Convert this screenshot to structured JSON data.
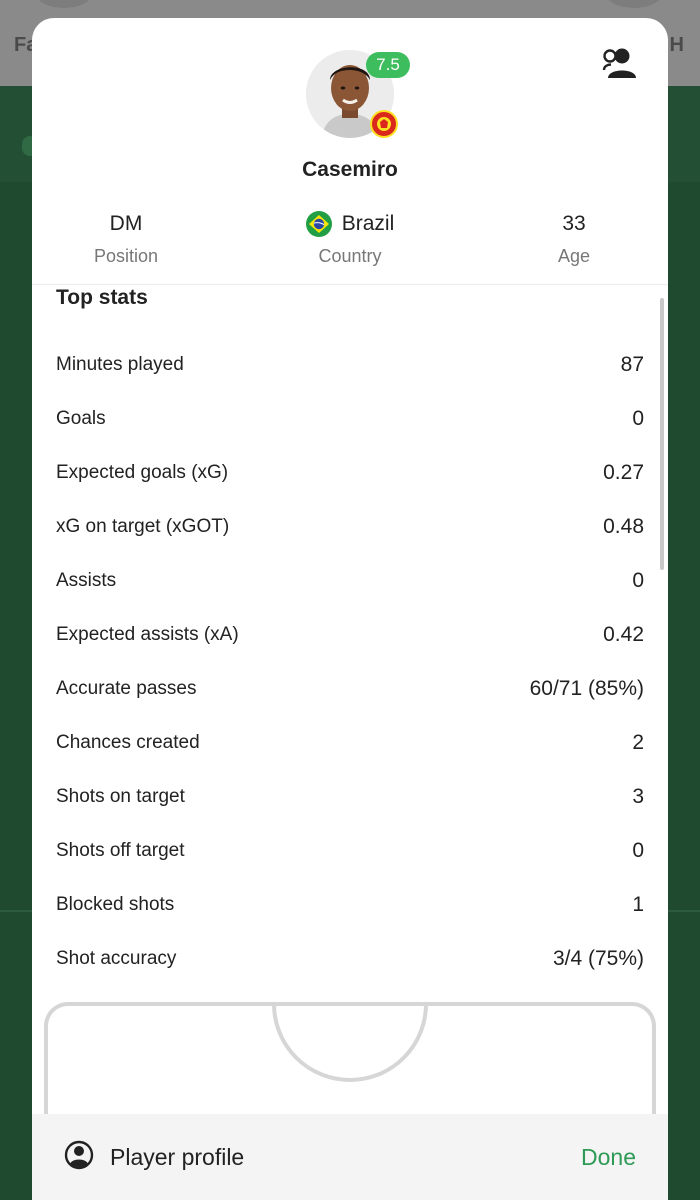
{
  "background": {
    "left_text": "Fa",
    "right_text": "H"
  },
  "player": {
    "name": "Casemiro",
    "rating": "7.5"
  },
  "info": {
    "position": {
      "value": "DM",
      "label": "Position"
    },
    "country": {
      "value": "Brazil",
      "label": "Country",
      "flag_icon": "brazil-flag"
    },
    "age": {
      "value": "33",
      "label": "Age"
    }
  },
  "top_stats": {
    "title": "Top stats",
    "rows": [
      {
        "label": "Minutes played",
        "value": "87"
      },
      {
        "label": "Goals",
        "value": "0"
      },
      {
        "label": "Expected goals (xG)",
        "value": "0.27"
      },
      {
        "label": "xG on target (xGOT)",
        "value": "0.48"
      },
      {
        "label": "Assists",
        "value": "0"
      },
      {
        "label": "Expected assists (xA)",
        "value": "0.42"
      },
      {
        "label": "Accurate passes",
        "value": "60/71 (85%)"
      },
      {
        "label": "Chances created",
        "value": "2"
      },
      {
        "label": "Shots on target",
        "value": "3"
      },
      {
        "label": "Shots off target",
        "value": "0"
      },
      {
        "label": "Blocked shots",
        "value": "1"
      },
      {
        "label": "Shot accuracy",
        "value": "3/4 (75%)"
      }
    ]
  },
  "footer": {
    "profile_label": "Player profile",
    "done_label": "Done"
  },
  "colors": {
    "accent": "#2e9a55",
    "rating": "#3dbd5e",
    "background_pitch": "#1f4a30"
  }
}
